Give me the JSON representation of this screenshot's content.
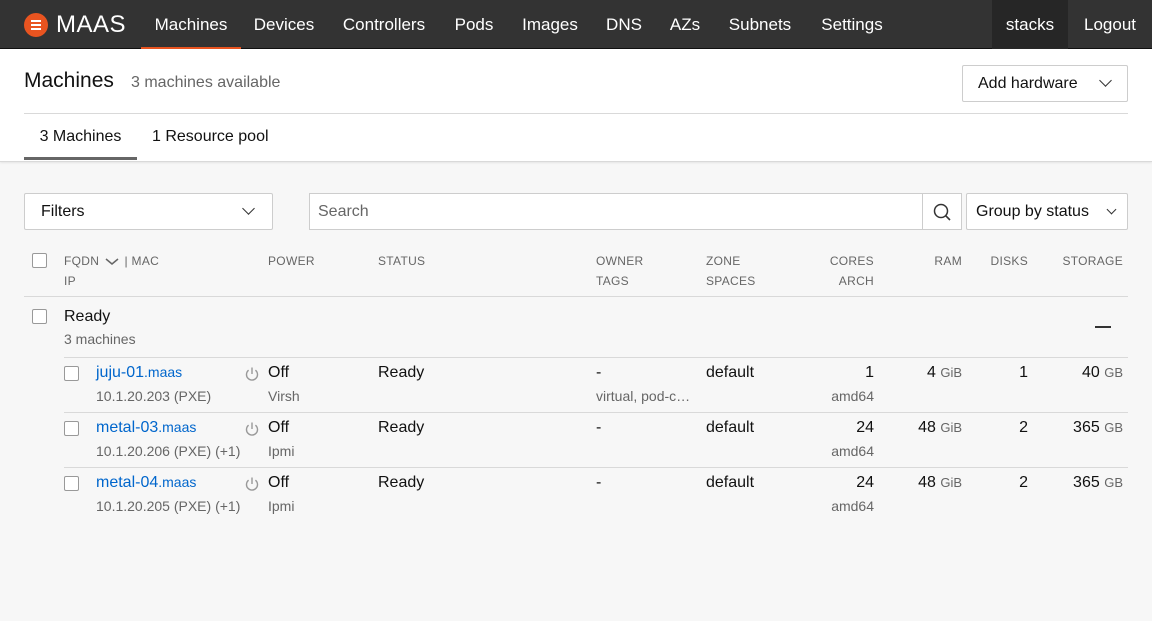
{
  "nav": {
    "logo": "MAAS",
    "items": [
      "Machines",
      "Devices",
      "Controllers",
      "Pods",
      "Images",
      "DNS",
      "AZs",
      "Subnets",
      "Settings"
    ],
    "user": "stacks",
    "logout": "Logout"
  },
  "header": {
    "title": "Machines",
    "subtitle": "3 machines available",
    "add_hardware": "Add hardware",
    "tabs": [
      "3 Machines",
      "1 Resource pool"
    ]
  },
  "controls": {
    "filters": "Filters",
    "search_placeholder": "Search",
    "group_by": "Group by status"
  },
  "table": {
    "headers": {
      "fqdn": "FQDN",
      "mac": "| MAC",
      "ip": "IP",
      "power": "POWER",
      "status": "STATUS",
      "owner": "OWNER",
      "tags": "TAGS",
      "zone": "ZONE",
      "spaces": "SPACES",
      "cores": "CORES",
      "arch": "ARCH",
      "ram": "RAM",
      "disks": "DISKS",
      "storage": "STORAGE"
    },
    "group": {
      "title": "Ready",
      "subtitle": "3 machines"
    },
    "rows": [
      {
        "name": "juju-01",
        "domain": ".maas",
        "ip": "10.1.20.203 (PXE)",
        "power": "Off",
        "power_type": "Virsh",
        "status": "Ready",
        "owner": "-",
        "tags": "virtual, pod-c…",
        "zone": "default",
        "cores": "1",
        "arch": "amd64",
        "ram": "4",
        "ram_unit": "GiB",
        "disks": "1",
        "storage": "40",
        "storage_unit": "GB"
      },
      {
        "name": "metal-03",
        "domain": ".maas",
        "ip": "10.1.20.206 (PXE) (+1)",
        "power": "Off",
        "power_type": "Ipmi",
        "status": "Ready",
        "owner": "-",
        "tags": "",
        "zone": "default",
        "cores": "24",
        "arch": "amd64",
        "ram": "48",
        "ram_unit": "GiB",
        "disks": "2",
        "storage": "365",
        "storage_unit": "GB"
      },
      {
        "name": "metal-04",
        "domain": ".maas",
        "ip": "10.1.20.205 (PXE) (+1)",
        "power": "Off",
        "power_type": "Ipmi",
        "status": "Ready",
        "owner": "-",
        "tags": "",
        "zone": "default",
        "cores": "24",
        "arch": "amd64",
        "ram": "48",
        "ram_unit": "GiB",
        "disks": "2",
        "storage": "365",
        "storage_unit": "GB"
      }
    ]
  },
  "colors": {
    "brand": "#e95420",
    "nav_bg": "#333333",
    "link": "#0066cc"
  }
}
